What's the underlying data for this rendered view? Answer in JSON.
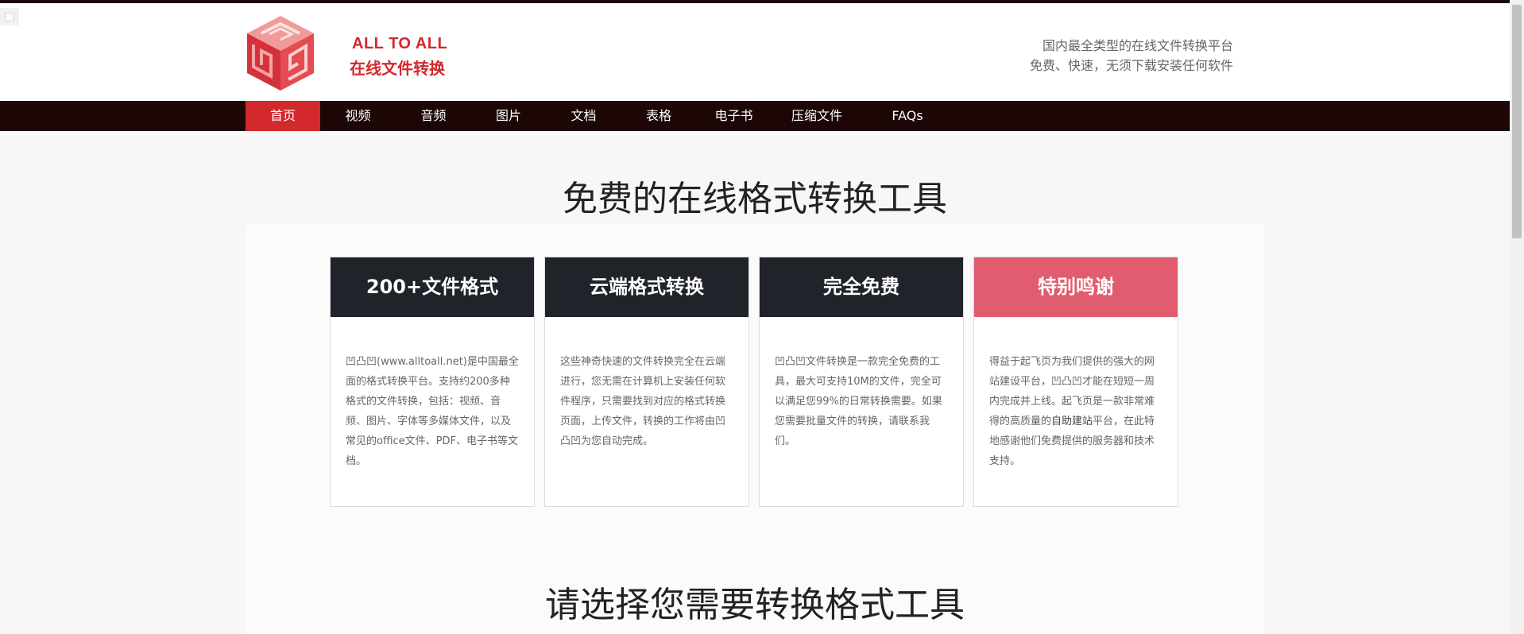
{
  "header": {
    "brand_en": "ALL TO ALL",
    "brand_cn": "在线文件转换",
    "tagline_1": "国内最全类型的在线文件转换平台",
    "tagline_2": "免费、快速，无须下载安装任何软件"
  },
  "nav": {
    "items": [
      {
        "label": "首页",
        "active": true
      },
      {
        "label": "视频"
      },
      {
        "label": "音频"
      },
      {
        "label": "图片"
      },
      {
        "label": "文档"
      },
      {
        "label": "表格"
      },
      {
        "label": "电子书"
      },
      {
        "label": "压缩文件"
      },
      {
        "label": "FAQs"
      }
    ]
  },
  "main": {
    "title": "免费的在线格式转换工具",
    "cards": [
      {
        "heading": "200+文件格式",
        "text": "凹凸凹(www.alltoall.net)是中国最全面的格式转换平台。支持约200多种格式的文件转换，包括：视频、音频、图片、字体等多媒体文件，以及常见的office文件、PDF、电子书等文档。"
      },
      {
        "heading": "云端格式转换",
        "text": "这些神奇快速的文件转换完全在云端进行，您无需在计算机上安装任何软件程序，只需要找到对应的格式转换页面，上传文件，转换的工作将由凹凸凹为您自动完成。"
      },
      {
        "heading": "完全免费",
        "text": "凹凸凹文件转换是一款完全免费的工具，最大可支持10M的文件，完全可以满足您99%的日常转换需要。如果您需要批量文件的转换，请联系我们。"
      },
      {
        "heading": "特别鸣谢",
        "text_before": "得益于起飞页为我们提供的强大的网站建设平台，凹凸凹才能在短短一周内完成并上线。起飞页是一款非常难得的高质量的",
        "text_link": "自助建站",
        "text_after": "平台，在此特地感谢他们免费提供的服务器和技术支持。"
      }
    ],
    "title_2": "请选择您需要转换格式工具"
  },
  "colors": {
    "accent": "#d3282c",
    "nav_bg": "#1c0606",
    "card_head": "#21232b",
    "card_head_highlight": "#e05c6e"
  },
  "icons": {
    "logo": "cube-logo-icon"
  }
}
